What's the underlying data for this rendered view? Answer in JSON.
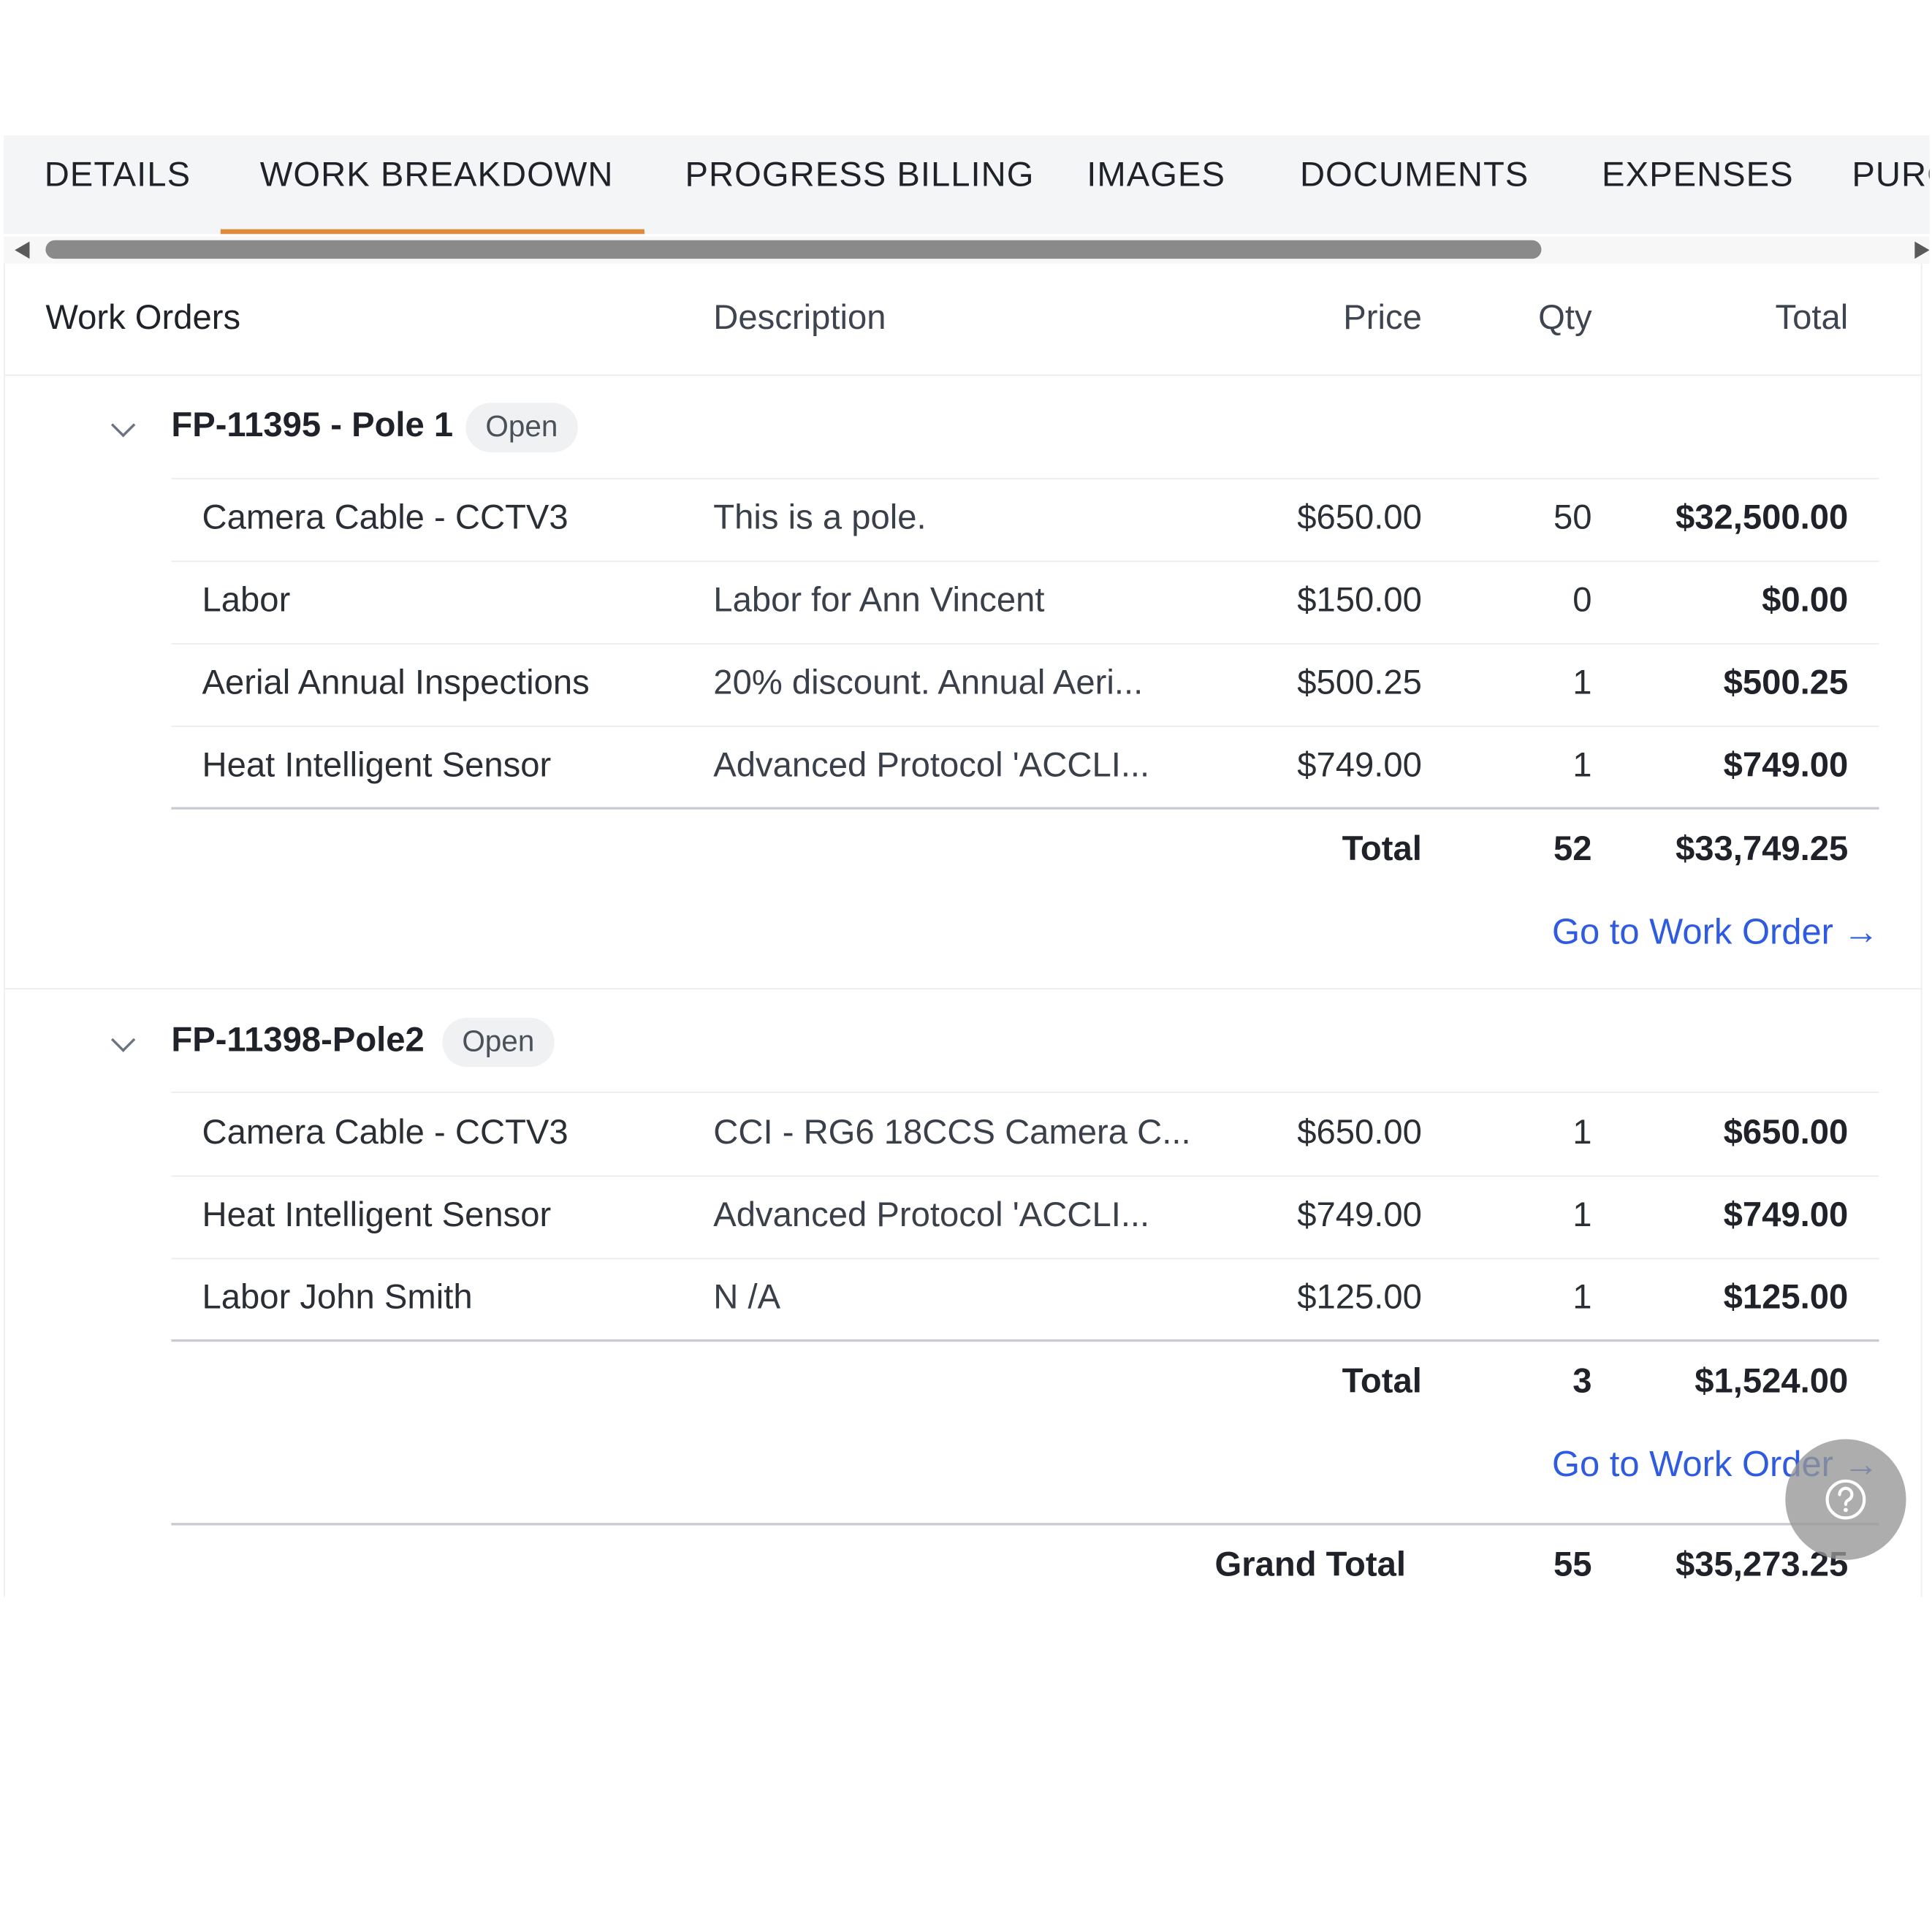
{
  "tabs": [
    {
      "label": "DETAILS"
    },
    {
      "label": "WORK BREAKDOWN"
    },
    {
      "label": "PROGRESS BILLING"
    },
    {
      "label": "IMAGES"
    },
    {
      "label": "DOCUMENTS"
    },
    {
      "label": "EXPENSES"
    },
    {
      "label": "PURC"
    }
  ],
  "columns": {
    "work_orders": "Work Orders",
    "description": "Description",
    "price": "Price",
    "qty": "Qty",
    "total": "Total"
  },
  "groups": [
    {
      "title": "FP-11395 - Pole 1",
      "status": "Open",
      "rows": [
        {
          "item": "Camera Cable - CCTV3",
          "description": "This is a pole.",
          "price": "$650.00",
          "qty": "50",
          "total": "$32,500.00"
        },
        {
          "item": "Labor",
          "description": "Labor for Ann Vincent",
          "price": "$150.00",
          "qty": "0",
          "total": "$0.00"
        },
        {
          "item": "Aerial Annual Inspections",
          "description": "20% discount. Annual Aeri...",
          "price": "$500.25",
          "qty": "1",
          "total": "$500.25"
        },
        {
          "item": "Heat Intelligent Sensor",
          "description": "Advanced Protocol 'ACCLI...",
          "price": "$749.00",
          "qty": "1",
          "total": "$749.00"
        }
      ],
      "total_label": "Total",
      "total_qty": "52",
      "total_amount": "$33,749.25",
      "link": "Go to Work Order →"
    },
    {
      "title": "FP-11398-Pole2",
      "status": "Open",
      "rows": [
        {
          "item": "Camera Cable - CCTV3",
          "description": "CCI - RG6 18CCS Camera C...",
          "price": "$650.00",
          "qty": "1",
          "total": "$650.00"
        },
        {
          "item": "Heat Intelligent Sensor",
          "description": "Advanced Protocol 'ACCLI...",
          "price": "$749.00",
          "qty": "1",
          "total": "$749.00"
        },
        {
          "item": "Labor John Smith",
          "description": "N /A",
          "price": "$125.00",
          "qty": "1",
          "total": "$125.00"
        }
      ],
      "total_label": "Total",
      "total_qty": "3",
      "total_amount": "$1,524.00",
      "link": "Go to Work Order →"
    }
  ],
  "grand_total": {
    "label": "Grand Total",
    "qty": "55",
    "amount": "$35,273.25"
  },
  "help_button": {
    "icon": "help-circle-icon",
    "color": "#969696"
  },
  "colors": {
    "active_tab_underline": "#e08a3c",
    "link": "#2f5be0"
  }
}
